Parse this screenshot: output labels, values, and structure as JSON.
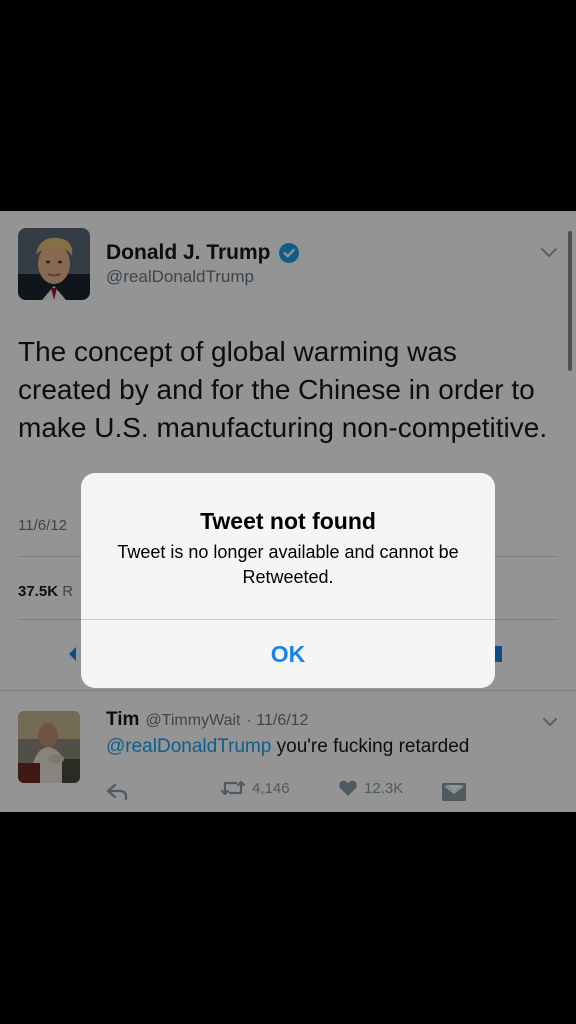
{
  "main_tweet": {
    "author_name": "Donald J. Trump",
    "handle": "@realDonaldTrump",
    "verified": true,
    "text": "The concept of global warming was created by and for the Chinese in order to make U.S. manufacturing non-competitive.",
    "date_visible": "11/6/12",
    "retweets_count": "37.5K",
    "retweets_label_partial": "R",
    "icons": [
      "verified-badge-icon",
      "chevron-down-icon",
      "reply-icon",
      "direct-message-icon"
    ]
  },
  "reply_tweet": {
    "author_name": "Tim",
    "handle": "@TimmyWait",
    "time": "· 11/6/12",
    "mention": "@realDonaldTrump",
    "text_rest": " you're fucking retarded",
    "retweet_count": "4,146",
    "like_count": "12.3K",
    "icons": [
      "reply-icon",
      "retweet-icon",
      "heart-icon",
      "direct-message-icon",
      "chevron-down-icon"
    ]
  },
  "alert": {
    "title": "Tweet not found",
    "message": "Tweet is no longer available and cannot be Retweeted.",
    "ok_label": "OK"
  },
  "colors": {
    "link_blue": "#1da1f2",
    "alert_button_blue": "#1a82e8",
    "secondary_text": "#657786",
    "primary_text": "#14171a",
    "overlay": "rgba(0,0,0,0.42)"
  }
}
